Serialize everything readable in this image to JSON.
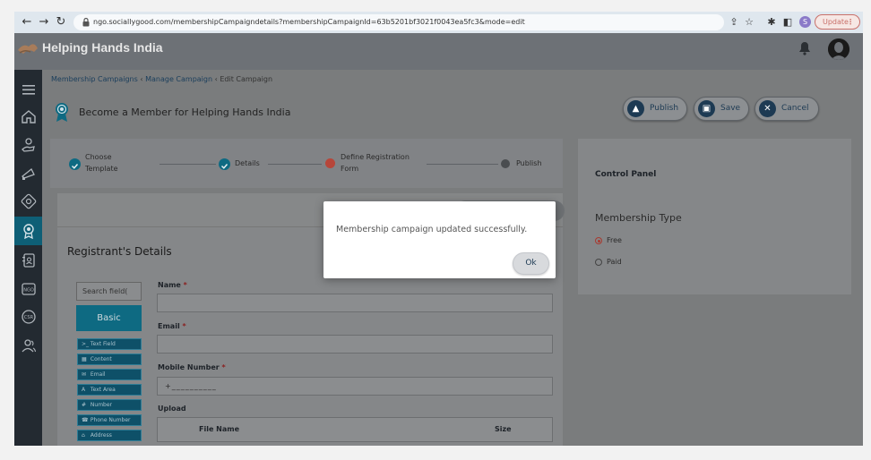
{
  "browser": {
    "url": "ngo.sociallygood.com/membershipCampaigndetails?membershipCampaignId=63b5201bf3021f0043ea5fc3&mode=edit",
    "profile_initial": "S",
    "update_label": "Update",
    "update_dots": "⋮"
  },
  "app": {
    "title": "Helping Hands India"
  },
  "breadcrumb": {
    "items": [
      "Membership Campaigns",
      "Manage Campaign",
      "Edit Campaign"
    ],
    "separator": "‹"
  },
  "campaign": {
    "title": "Become a Member for Helping Hands India"
  },
  "actions": {
    "publish": "Publish",
    "save": "Save",
    "cancel": "Cancel"
  },
  "stepper": {
    "steps": [
      {
        "label_line1": "Choose",
        "label_line2": "Template",
        "state": "done"
      },
      {
        "label_line1": "Details",
        "label_line2": "",
        "state": "done"
      },
      {
        "label_line1": "Define Registration",
        "label_line2": "Form",
        "state": "current"
      },
      {
        "label_line1": "Publish",
        "label_line2": "",
        "state": "pending"
      }
    ]
  },
  "control_panel": {
    "title": "Control Panel",
    "membership_type_label": "Membership Type",
    "options": [
      {
        "label": "Free",
        "selected": true
      },
      {
        "label": "Paid",
        "selected": false
      }
    ]
  },
  "form": {
    "section_title": "Registrant's Details",
    "search_placeholder": "Search field(",
    "basic_label": "Basic",
    "palette": [
      {
        "icon": ">_",
        "label": "Text Field"
      },
      {
        "icon": "▦",
        "label": "Content"
      },
      {
        "icon": "✉",
        "label": "Email"
      },
      {
        "icon": "A",
        "label": "Text Area"
      },
      {
        "icon": "#",
        "label": "Number"
      },
      {
        "icon": "☎",
        "label": "Phone Number"
      },
      {
        "icon": "⌂",
        "label": "Address"
      }
    ],
    "fields": {
      "name_label": "Name",
      "email_label": "Email",
      "mobile_label": "Mobile Number",
      "mobile_placeholder": "+__________",
      "upload_label": "Upload",
      "required_mark": "*"
    },
    "upload_table": {
      "col_file": "File Name",
      "col_size": "Size"
    }
  },
  "modal": {
    "message": "Membership campaign updated successfully.",
    "ok_label": "Ok"
  },
  "colors": {
    "accent": "#0e6a82",
    "current_step": "#c0392b",
    "done_step": "#0e6a82"
  }
}
